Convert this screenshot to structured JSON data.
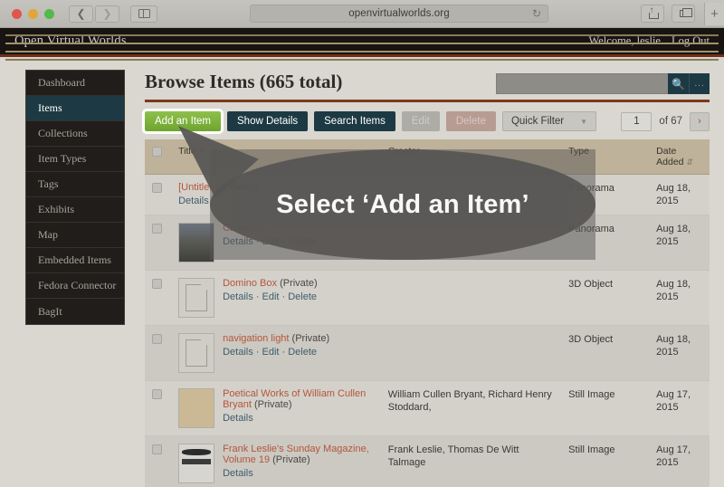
{
  "browser": {
    "url": "openvirtualworlds.org",
    "back_icon": "chevron-left-icon",
    "forward_icon": "chevron-right-icon",
    "sidebar_icon": "sidebar-toggle-icon",
    "reload_icon": "↻",
    "share_icon": "share-icon",
    "tabs_icon": "tabs-icon",
    "newtab_label": "+"
  },
  "topbar": {
    "brand": "Open Virtual Worlds",
    "welcome": "Welcome, leslie",
    "logout": "Log Out"
  },
  "sidebar": {
    "items": [
      {
        "label": "Dashboard",
        "active": false
      },
      {
        "label": "Items",
        "active": true
      },
      {
        "label": "Collections",
        "active": false
      },
      {
        "label": "Item Types",
        "active": false
      },
      {
        "label": "Tags",
        "active": false
      },
      {
        "label": "Exhibits",
        "active": false
      },
      {
        "label": "Map",
        "active": false
      },
      {
        "label": "Embedded Items",
        "active": false
      },
      {
        "label": "Fedora Connector",
        "active": false
      },
      {
        "label": "BagIt",
        "active": false
      }
    ]
  },
  "main": {
    "title": "Browse Items (665 total)",
    "search_value": "",
    "search_placeholder": "",
    "search_button_icon": "search-icon",
    "search_options_label": "...",
    "toolbar": {
      "add_item": "Add an Item",
      "show_details": "Show Details",
      "search_items": "Search Items",
      "edit": "Edit",
      "delete": "Delete",
      "quick_filter": "Quick Filter"
    },
    "pager": {
      "page_value": "1",
      "of_label": "of 67",
      "next_label": "›"
    },
    "table": {
      "headers": [
        "",
        "Title",
        "Creator",
        "Type",
        "Date Added"
      ],
      "rows": [
        {
          "title": "[Untitled]",
          "private": "(Private)",
          "actions": "Details",
          "creator": "",
          "type": "Panorama",
          "date": "Aug 18, 2015",
          "thumb": "none"
        },
        {
          "title": "Castlecr…",
          "private": "",
          "actions": "Details · Edit · Delete",
          "creator": "",
          "type": "Panorama",
          "date": "Aug 18, 2015",
          "thumb": "photo"
        },
        {
          "title": "Domino Box",
          "private": "(Private)",
          "actions": "Details · Edit · Delete",
          "creator": "",
          "type": "3D Object",
          "date": "Aug 18, 2015",
          "thumb": "doc"
        },
        {
          "title": "navigation light",
          "private": "(Private)",
          "actions": "Details · Edit · Delete",
          "creator": "",
          "type": "3D Object",
          "date": "Aug 18, 2015",
          "thumb": "doc"
        },
        {
          "title": "Poetical Works of William Cullen Bryant",
          "private": "(Private)",
          "actions": "Details",
          "creator": "William Cullen Bryant, Richard Henry Stoddard,",
          "type": "Still Image",
          "date": "Aug 17, 2015",
          "thumb": "book"
        },
        {
          "title": "Frank Leslie's Sunday Magazine, Volume 19",
          "private": "(Private)",
          "actions": "Details",
          "creator": "Frank Leslie, Thomas De Witt Talmage",
          "type": "Still Image",
          "date": "Aug 17, 2015",
          "thumb": "news"
        }
      ]
    }
  },
  "callout": {
    "text": "Select ‘Add an Item’"
  },
  "colors": {
    "accent_green": "#7cb03a",
    "accent_dark": "#1d3a44",
    "rule_brown": "#7c3a1d",
    "link_orange": "#b5553a",
    "callout_gray": "#585654"
  }
}
